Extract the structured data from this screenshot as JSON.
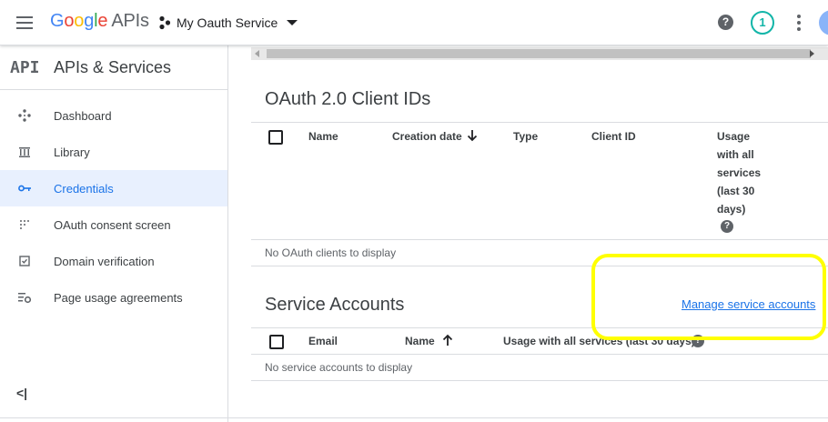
{
  "header": {
    "logo_letters": [
      "G",
      "o",
      "o",
      "g",
      "l",
      "e"
    ],
    "logo_suffix": "APIs",
    "project_name": "My Oauth Service",
    "help_glyph": "?",
    "notification_count": "1",
    "icons": [
      "menu-icon",
      "project-icon",
      "help-icon",
      "more-vert-icon"
    ]
  },
  "sidebar": {
    "mark": "API",
    "title": "APIs & Services",
    "items": [
      {
        "label": "Dashboard",
        "icon": "dashboard-icon",
        "active": false
      },
      {
        "label": "Library",
        "icon": "library-icon",
        "active": false
      },
      {
        "label": "Credentials",
        "icon": "key-icon",
        "active": true
      },
      {
        "label": "OAuth consent screen",
        "icon": "consent-icon",
        "active": false
      },
      {
        "label": "Domain verification",
        "icon": "domain-check-icon",
        "active": false
      },
      {
        "label": "Page usage agreements",
        "icon": "settings-list-icon",
        "active": false
      }
    ],
    "collapse_glyph": "<|"
  },
  "oauth": {
    "title": "OAuth 2.0 Client IDs",
    "columns": {
      "name": "Name",
      "creation_date": "Creation date",
      "type": "Type",
      "client_id": "Client ID",
      "usage_lines": [
        "Usage",
        "with all",
        "services",
        "(last 30",
        "days)"
      ]
    },
    "sort_direction": "descending",
    "empty_text": "No OAuth clients to display"
  },
  "service_accounts": {
    "title": "Service Accounts",
    "manage_link": "Manage service accounts",
    "columns": {
      "email": "Email",
      "name": "Name",
      "usage": "Usage with all services (last 30 days)"
    },
    "sort_direction": "ascending",
    "empty_text": "No service accounts to display"
  },
  "colors": {
    "accent": "#1a73e8",
    "active_bg": "#e8f0fe",
    "highlight": "#ffff00",
    "notification": "#12b5a8"
  }
}
